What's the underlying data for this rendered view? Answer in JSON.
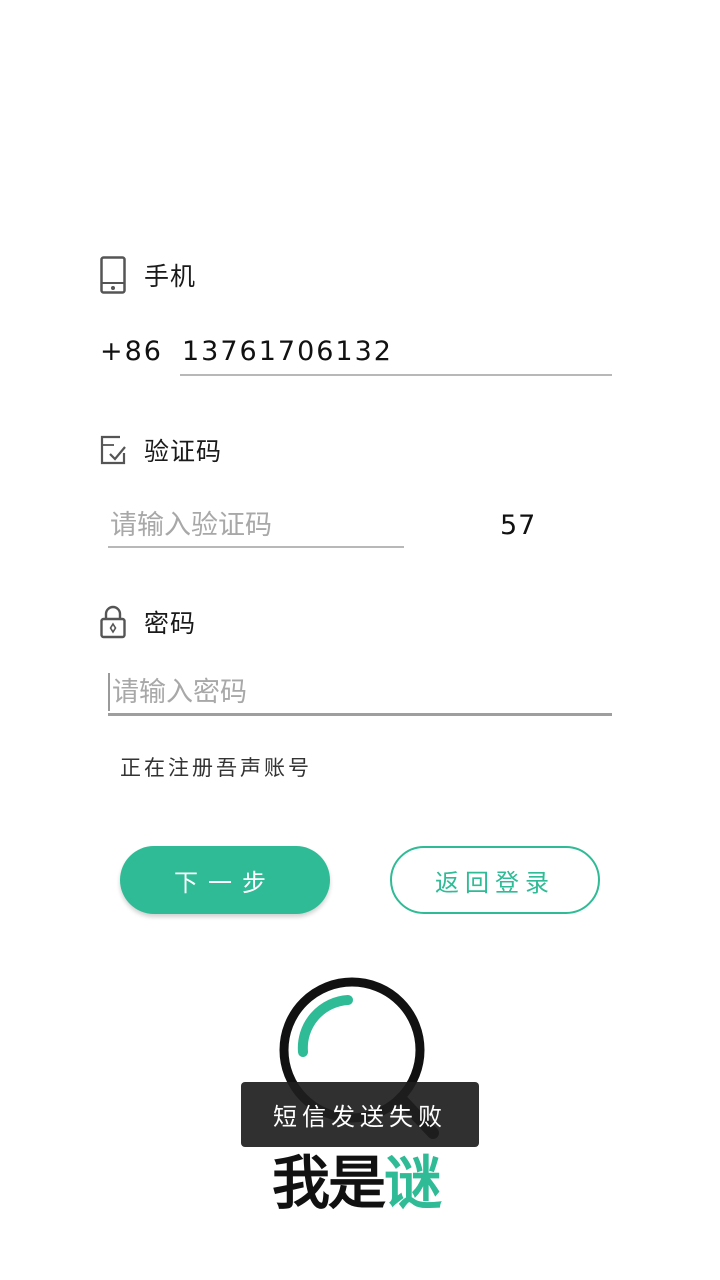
{
  "form": {
    "phone": {
      "label": "手机",
      "icon": "phone-icon",
      "country_code": "+86",
      "value": "13761706132"
    },
    "code": {
      "label": "验证码",
      "icon": "checkbox-icon",
      "placeholder": "请输入验证码",
      "value": "",
      "countdown": "57"
    },
    "password": {
      "label": "密码",
      "icon": "lock-icon",
      "placeholder": "请输入密码",
      "value": ""
    },
    "status_text": "正在注册吾声账号"
  },
  "buttons": {
    "next_label": "下一步",
    "back_label": "返回登录"
  },
  "logo": {
    "text_main": "我是",
    "text_accent": "谜",
    "icon": "magnifier-logo-icon"
  },
  "toast": {
    "message": "短信发送失败"
  },
  "colors": {
    "accent": "#2fbb95",
    "divider": "#b8b8b8",
    "placeholder": "#a8a8a8",
    "toast_bg": "#1e1e1e"
  }
}
